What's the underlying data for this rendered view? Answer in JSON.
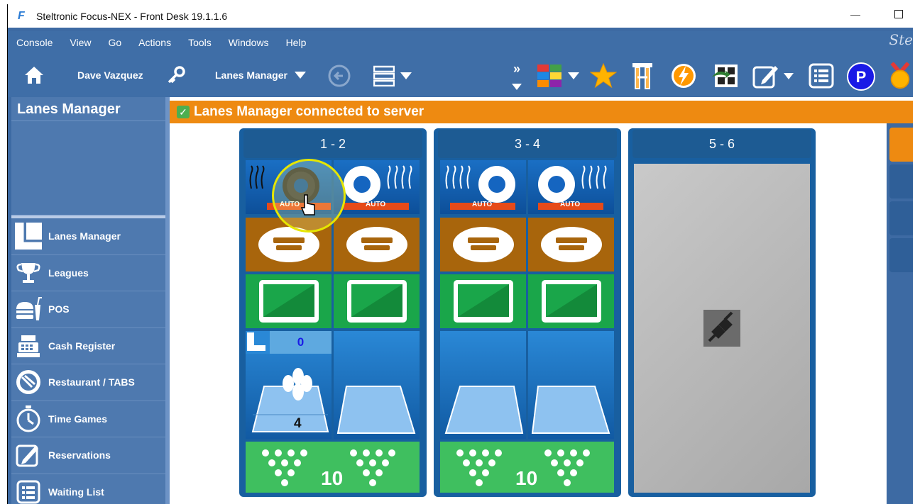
{
  "window": {
    "title": "Steltronic Focus-NEX - Front Desk 19.1.1.6",
    "minimize": "—"
  },
  "menu": {
    "items": [
      "Console",
      "View",
      "Go",
      "Actions",
      "Tools",
      "Windows",
      "Help"
    ],
    "brand": "Ste"
  },
  "toolbar": {
    "user": "Dave Vazquez",
    "view_select": "Lanes Manager",
    "more": "»"
  },
  "sidebar": {
    "title": "Lanes Manager",
    "items": [
      {
        "label": "Lanes Manager",
        "icon": "lanes-icon"
      },
      {
        "label": "Leagues",
        "icon": "trophy-icon"
      },
      {
        "label": "POS",
        "icon": "food-icon"
      },
      {
        "label": "Cash Register",
        "icon": "cash-register-icon"
      },
      {
        "label": "Restaurant / TABS",
        "icon": "restaurant-icon"
      },
      {
        "label": "Time Games",
        "icon": "stopwatch-icon"
      },
      {
        "label": "Reservations",
        "icon": "reservations-icon"
      },
      {
        "label": "Waiting List",
        "icon": "list-icon"
      }
    ]
  },
  "banner": {
    "text": "Lanes Manager connected to server"
  },
  "lanes": {
    "pairs": [
      {
        "label": "1 - 2",
        "auto_left": "AUTO",
        "auto_right": "AUTO",
        "counter": "0",
        "score": "4",
        "pins": "10"
      },
      {
        "label": "3 - 4",
        "auto_left": "AUTO",
        "auto_right": "AUTO",
        "pins": "10"
      },
      {
        "label": "5 - 6"
      }
    ]
  },
  "colors": {
    "accent_orange": "#ee8a11",
    "sidebar_blue": "#4e79af",
    "lane_blue": "#185fa0",
    "keyboard_brown": "#a8650c",
    "monitor_green": "#1aa64a",
    "pins_green": "#3fbf5f"
  }
}
